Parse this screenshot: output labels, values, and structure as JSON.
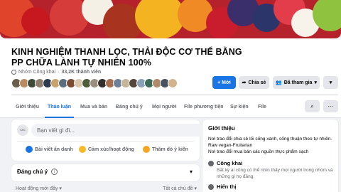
{
  "group": {
    "title": "KINH NGHIỆM THANH LỌC, THẢI ĐỘC CƠ THỂ BẰNG PP CHỮA LÀNH TỰ NHIÊN 100%",
    "privacy": "Nhóm Công khai",
    "separator": "·",
    "members": "33,2K thành viên"
  },
  "actions": {
    "invite": "+ Mời",
    "share": "Chia sẻ",
    "joined": "Đã tham gia",
    "more": "▾"
  },
  "tabs": [
    {
      "label": "Giới thiệu"
    },
    {
      "label": "Thảo luận"
    },
    {
      "label": "Mua và bán"
    },
    {
      "label": "Đáng chú ý"
    },
    {
      "label": "Mọi người"
    },
    {
      "label": "File phương tiện"
    },
    {
      "label": "Sự kiện"
    },
    {
      "label": "File"
    }
  ],
  "tab_icons": {
    "search": "search-icon",
    "more": "more-icon"
  },
  "composer": {
    "avatar_text": "ccc",
    "placeholder": "Bạn viết gì đi...",
    "actions": [
      {
        "label": "Bài viết ẩn danh",
        "color": "#1b74e4"
      },
      {
        "label": "Cảm xúc/hoạt động",
        "color": "#f7b928"
      },
      {
        "label": "Thăm dò ý kiến",
        "color": "#f5a623"
      }
    ]
  },
  "featured": {
    "title": "Đáng chú ý",
    "info": "i",
    "chevron": "▾"
  },
  "sort": {
    "left": "Hoạt động mới đây ▾",
    "right": "Tất cả chủ đề ▾"
  },
  "about": {
    "heading": "Giới thiệu",
    "description": "Nơi trao đổi chia sẻ lối sống xanh, sống thuận theo tự nhiên. Raw vegan-Fruitarian\nNơi trao đổi mua bán các nguồn thực phẩm sạch",
    "public_title": "Công khai",
    "public_text": "Bất kỳ ai cũng có thể nhìn thấy mọi người trong nhóm và những gì họ đăng.",
    "visible_title": "Hiển thị"
  },
  "colors": {
    "accent": "#1b74e4",
    "muted": "#65676b"
  }
}
